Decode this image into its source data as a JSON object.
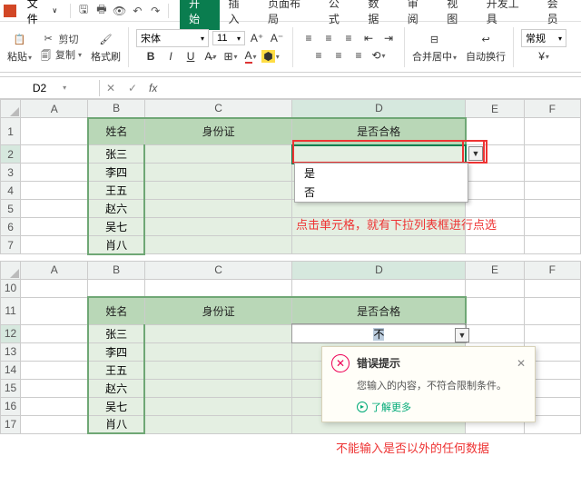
{
  "titlebar": {
    "file": "文件"
  },
  "tabs": [
    "开始",
    "插入",
    "页面布局",
    "公式",
    "数据",
    "审阅",
    "视图",
    "开发工具",
    "会员"
  ],
  "ribbon": {
    "paste": "粘贴",
    "cut": "剪切",
    "copy": "复制",
    "fmtpaint": "格式刷",
    "font": "宋体",
    "size": "11",
    "merge": "合并居中",
    "wrap": "自动换行",
    "general": "常规"
  },
  "formula": {
    "cell": "D2"
  },
  "cols": [
    "A",
    "B",
    "C",
    "D",
    "E",
    "F"
  ],
  "sheet1": {
    "rows": [
      "1",
      "2",
      "3",
      "4",
      "5",
      "6",
      "7"
    ],
    "headers": {
      "name": "姓名",
      "id": "身份证",
      "pass": "是否合格"
    },
    "names": [
      "张三",
      "李四",
      "王五",
      "赵六",
      "吴七",
      "肖八"
    ],
    "dd": [
      "是",
      "否"
    ],
    "note": "点击单元格，就有下拉列表框进行点选"
  },
  "sheet2": {
    "rows": [
      "10",
      "11",
      "12",
      "13",
      "14",
      "15",
      "16",
      "17"
    ],
    "headers": {
      "name": "姓名",
      "id": "身份证",
      "pass": "是否合格"
    },
    "names": [
      "张三",
      "李四",
      "王五",
      "赵六",
      "吴七",
      "肖八"
    ],
    "input": "不",
    "note": "不能输入是否以外的任何数据",
    "err": {
      "title": "错误提示",
      "msg": "您输入的内容，不符合限制条件。",
      "link": "了解更多"
    }
  }
}
